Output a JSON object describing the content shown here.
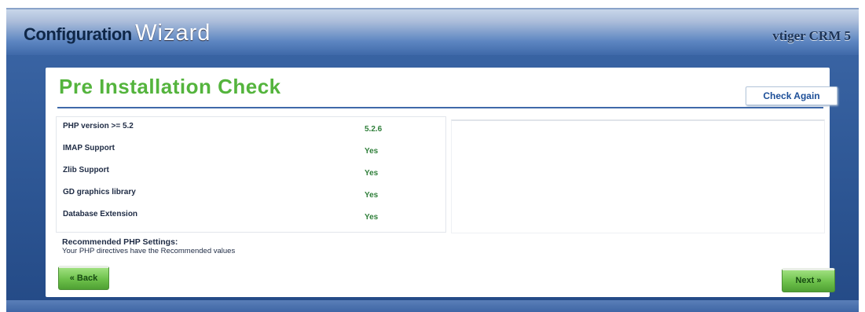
{
  "header": {
    "title_part1": "Configuration",
    "title_part2": "Wizard",
    "product": "vtiger CRM 5"
  },
  "page": {
    "title": "Pre Installation Check",
    "check_again_label": "Check Again"
  },
  "checks": [
    {
      "label": "PHP version >= 5.2",
      "value": "5.2.6"
    },
    {
      "label": "IMAP Support",
      "value": "Yes"
    },
    {
      "label": "Zlib Support",
      "value": "Yes"
    },
    {
      "label": "GD graphics library",
      "value": "Yes"
    },
    {
      "label": "Database Extension",
      "value": "Yes"
    }
  ],
  "recommended": {
    "heading": "Recommended PHP Settings:",
    "message": "Your PHP directives have the Recommended values"
  },
  "nav": {
    "back_label": "« Back",
    "next_label": "Next »"
  },
  "colors": {
    "title_green": "#54b43d",
    "value_green": "#2f7f3a",
    "frame_blue": "#2e5795",
    "button_green": "#6cc04a"
  }
}
